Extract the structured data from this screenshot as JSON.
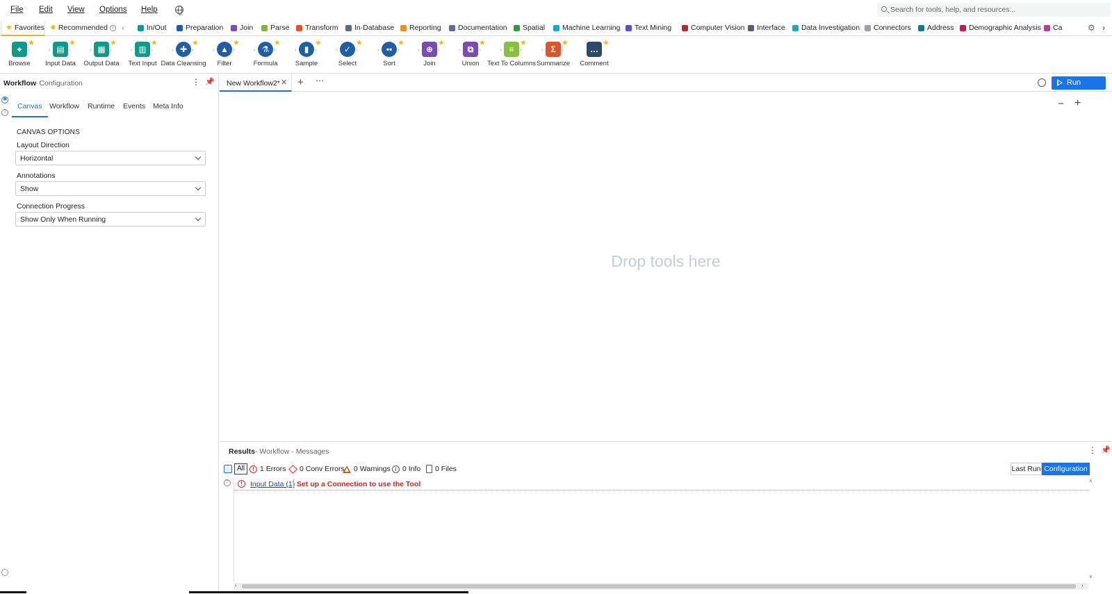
{
  "menu": {
    "file": "File",
    "edit": "Edit",
    "view": "View",
    "options": "Options",
    "help": "Help"
  },
  "search": {
    "placeholder": "Search for tools, help, and resources..."
  },
  "category_tabs": {
    "favorites": "Favorites",
    "recommended": "Recommended",
    "items": [
      {
        "label": "In/Out",
        "color": "#0f9a8a"
      },
      {
        "label": "Preparation",
        "color": "#1f5ea8"
      },
      {
        "label": "Join",
        "color": "#7a4bb0"
      },
      {
        "label": "Parse",
        "color": "#7cb342"
      },
      {
        "label": "Transform",
        "color": "#e0532b"
      },
      {
        "label": "In-Database",
        "color": "#5d6b7a"
      },
      {
        "label": "Reporting",
        "color": "#e8902a"
      },
      {
        "label": "Documentation",
        "color": "#5f6e8c"
      },
      {
        "label": "Spatial",
        "color": "#2e9a3a"
      },
      {
        "label": "Machine Learning",
        "color": "#1aa6c9"
      },
      {
        "label": "Text Mining",
        "color": "#5a4fcf"
      },
      {
        "label": "Computer Vision",
        "color": "#b3283a"
      },
      {
        "label": "Interface",
        "color": "#556070"
      },
      {
        "label": "Data Investigation",
        "color": "#2aa3b0"
      },
      {
        "label": "Connectors",
        "color": "#9aa0a6"
      },
      {
        "label": "Address",
        "color": "#0f7a8a"
      },
      {
        "label": "Demographic Analysis",
        "color": "#c2185b"
      },
      {
        "label": "Ca",
        "color": "#b0409a"
      }
    ]
  },
  "tools": [
    {
      "label": "Browse",
      "color": "#0f9a8a",
      "glyph": "⌖"
    },
    {
      "label": "Input Data",
      "color": "#0f9a8a",
      "glyph": "▤"
    },
    {
      "label": "Output Data",
      "color": "#0f9a8a",
      "glyph": "▦"
    },
    {
      "label": "Text Input",
      "color": "#0f9a8a",
      "glyph": "▥"
    },
    {
      "label": "Data Cleansing",
      "color": "#1f5ea8",
      "glyph": "✚"
    },
    {
      "label": "Filter",
      "color": "#1f5ea8",
      "glyph": "▲"
    },
    {
      "label": "Formula",
      "color": "#1f5ea8",
      "glyph": "⚗"
    },
    {
      "label": "Sample",
      "color": "#1f5ea8",
      "glyph": "▮"
    },
    {
      "label": "Select",
      "color": "#1f5ea8",
      "glyph": "✓"
    },
    {
      "label": "Sort",
      "color": "#1f5ea8",
      "glyph": "••"
    },
    {
      "label": "Join",
      "color": "#7a4bb0",
      "glyph": "⊕"
    },
    {
      "label": "Union",
      "color": "#7a4bb0",
      "glyph": "⧉"
    },
    {
      "label": "Text To Columns",
      "color": "#8bbf3e",
      "glyph": "≡"
    },
    {
      "label": "Summarize",
      "color": "#e0532b",
      "glyph": "Σ"
    },
    {
      "label": "Comment",
      "color": "#2b4a6b",
      "glyph": "…"
    }
  ],
  "left_panel": {
    "title": "Workflow",
    "subtitle": "- Configuration",
    "tabs": [
      "Canvas",
      "Workflow",
      "Runtime",
      "Events",
      "Meta Info"
    ],
    "section": "CANVAS OPTIONS",
    "fields": [
      {
        "label": "Layout Direction",
        "value": "Horizontal"
      },
      {
        "label": "Annotations",
        "value": "Show"
      },
      {
        "label": "Connection Progress",
        "value": "Show Only When Running"
      }
    ]
  },
  "document": {
    "tab_label": "New Workflow2*",
    "run_label": "Run",
    "drop_hint": "Drop tools here"
  },
  "results": {
    "title": "Results",
    "subtitle": "- Workflow - Messages",
    "filters": {
      "all": "All",
      "errors": "1 Errors",
      "conv_errors": "0 Conv Errors",
      "warnings": "0 Warnings",
      "info": "0 Info",
      "files": "0 Files"
    },
    "last_run": "Last Run",
    "configuration": "Configuration",
    "message": {
      "tool": "Input Data (1)",
      "text": "Set up a Connection to use the Tool"
    }
  }
}
